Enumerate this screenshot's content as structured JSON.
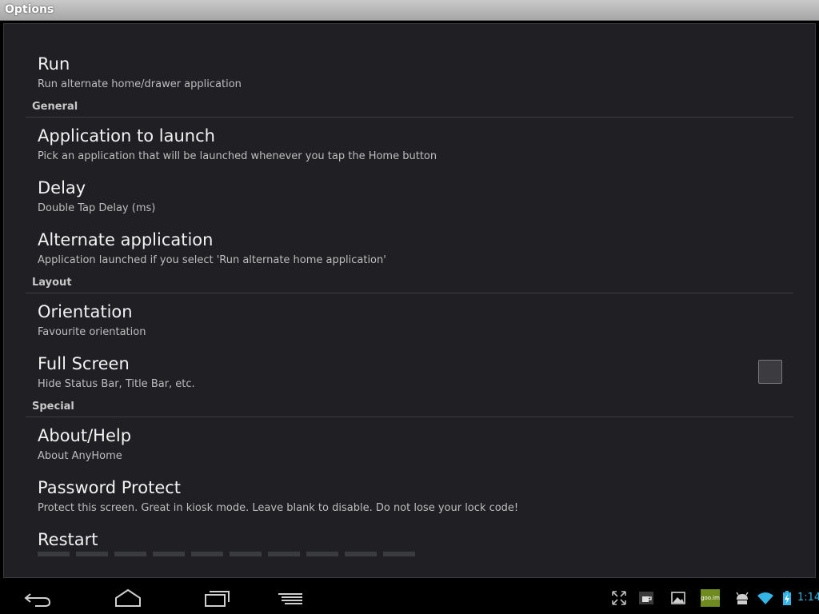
{
  "window": {
    "title": "Options"
  },
  "items": [
    {
      "title": "Run",
      "summary": "Run alternate home/drawer application"
    },
    {
      "title": "Application to launch",
      "summary": "Pick an application that will be launched whenever you tap the Home button"
    },
    {
      "title": "Delay",
      "summary": "Double Tap Delay (ms)"
    },
    {
      "title": "Alternate application",
      "summary": "Application launched if you select 'Run alternate home application'"
    },
    {
      "title": "Orientation",
      "summary": "Favourite orientation"
    },
    {
      "title": "Full Screen",
      "summary": "Hide Status Bar, Title Bar, etc.",
      "checked": false
    },
    {
      "title": "About/Help",
      "summary": "About AnyHome"
    },
    {
      "title": "Password Protect",
      "summary": "Protect this screen. Great in kiosk mode. Leave blank to disable. Do not lose your lock code!"
    },
    {
      "title": "Restart",
      "summary": ""
    }
  ],
  "sections": [
    {
      "label": "General"
    },
    {
      "label": "Layout"
    },
    {
      "label": "Special"
    }
  ],
  "statusbar": {
    "time": "1:14",
    "notif_label": "goo.im"
  },
  "colors": {
    "background": "#202024",
    "accent": "#33b5e5",
    "titlebar": "#b4b4b4"
  }
}
